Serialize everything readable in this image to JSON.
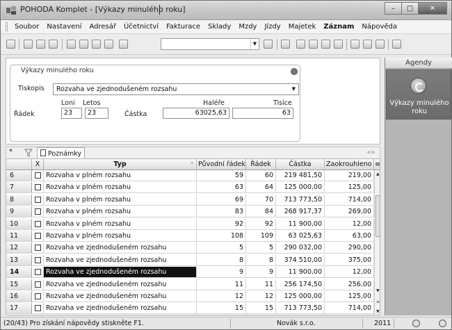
{
  "window": {
    "title": "POHODA Komplet - [Výkazy minulého roku]",
    "buttons": [
      "minimize-icon",
      "maximize-icon",
      "close-icon"
    ]
  },
  "menu": [
    {
      "label": "Soubor",
      "bold": false
    },
    {
      "label": "Nastavení",
      "bold": false
    },
    {
      "label": "Adresář",
      "bold": false
    },
    {
      "label": "Účetnictví",
      "bold": false
    },
    {
      "label": "Fakturace",
      "bold": false
    },
    {
      "label": "Sklady",
      "bold": false
    },
    {
      "label": "Mzdy",
      "bold": false
    },
    {
      "label": "Jízdy",
      "bold": false
    },
    {
      "label": "Majetek",
      "bold": false
    },
    {
      "label": "Záznam",
      "bold": true
    },
    {
      "label": "Nápověda",
      "bold": false
    }
  ],
  "form": {
    "group_title": "Výkazy minulého roku",
    "tiskopis_label": "Tiskopis",
    "tiskopis_value": "Rozvaha ve zjednodušeném rozsahu",
    "radek_label": "Řádek",
    "loni_label": "Loni",
    "letos_label": "Letos",
    "loni_value": "23",
    "letos_value": "23",
    "castka_label": "Částka",
    "halere_label": "Haléře",
    "tisice_label": "Tisíce",
    "halere_value": "63025,63",
    "tisice_value": "63"
  },
  "sidebar": {
    "header": "Agendy",
    "tile_label": "Výkazy minulého roku"
  },
  "tabs": {
    "star": "*",
    "notes_label": "Poznámky"
  },
  "grid": {
    "columns": {
      "x": "X",
      "typ": "Typ",
      "puvodni": "Původní řádek",
      "radek": "Řádek",
      "castka": "Částka",
      "zaokrouhleno": "Zaokrouhleno"
    },
    "rows": [
      {
        "n": "6",
        "typ": "Rozvaha v plném rozsahu",
        "puvodni": "59",
        "radek": "60",
        "castka": "219 481,50",
        "zaok": "219,00"
      },
      {
        "n": "7",
        "typ": "Rozvaha v plném rozsahu",
        "puvodni": "63",
        "radek": "64",
        "castka": "125 000,00",
        "zaok": "125,00"
      },
      {
        "n": "8",
        "typ": "Rozvaha v plném rozsahu",
        "puvodni": "69",
        "radek": "70",
        "castka": "713 773,50",
        "zaok": "714,00"
      },
      {
        "n": "9",
        "typ": "Rozvaha v plném rozsahu",
        "puvodni": "83",
        "radek": "84",
        "castka": "268 917,37",
        "zaok": "269,00"
      },
      {
        "n": "10",
        "typ": "Rozvaha v plném rozsahu",
        "puvodni": "92",
        "radek": "92",
        "castka": "11 900,00",
        "zaok": "12,00"
      },
      {
        "n": "11",
        "typ": "Rozvaha v plném rozsahu",
        "puvodni": "108",
        "radek": "109",
        "castka": "63 025,63",
        "zaok": "63,00"
      },
      {
        "n": "12",
        "typ": "Rozvaha ve zjednodušeném rozsahu",
        "puvodni": "5",
        "radek": "5",
        "castka": "290 032,00",
        "zaok": "290,00"
      },
      {
        "n": "13",
        "typ": "Rozvaha ve zjednodušeném rozsahu",
        "puvodni": "8",
        "radek": "8",
        "castka": "374 510,00",
        "zaok": "375,00"
      },
      {
        "n": "14",
        "typ": "Rozvaha ve zjednodušeném rozsahu",
        "puvodni": "9",
        "radek": "9",
        "castka": "11 900,00",
        "zaok": "12,00"
      },
      {
        "n": "15",
        "typ": "Rozvaha ve zjednodušeném rozsahu",
        "puvodni": "11",
        "radek": "11",
        "castka": "256 174,50",
        "zaok": "256,00"
      },
      {
        "n": "16",
        "typ": "Rozvaha ve zjednodušeném rozsahu",
        "puvodni": "12",
        "radek": "12",
        "castka": "125 000,00",
        "zaok": "125,00"
      },
      {
        "n": "17",
        "typ": "Rozvaha ve zjednodušeném rozsahu",
        "puvodni": "15",
        "radek": "15",
        "castka": "713 773,50",
        "zaok": "714,00"
      }
    ],
    "selected_row": 8
  },
  "status": {
    "text": "(20/43) Pro získání nápovědy stiskněte F1.",
    "company": "Novák s.r.o.",
    "year": "2011"
  }
}
